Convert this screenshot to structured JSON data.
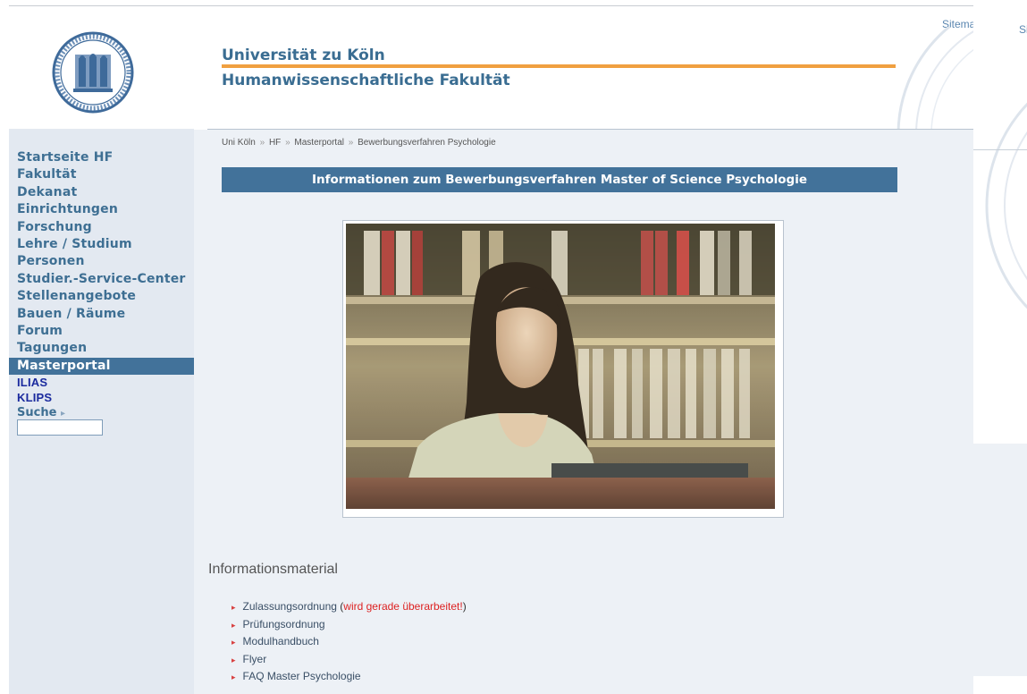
{
  "header": {
    "university": "Universität zu Köln",
    "faculty": "Humanwissenschaftliche Fakultät",
    "sitemap_link": "Sitemap",
    "right_pane_fragment": "Si"
  },
  "sidebar": {
    "items": [
      {
        "label": "Startseite HF"
      },
      {
        "label": "Fakultät"
      },
      {
        "label": "Dekanat"
      },
      {
        "label": "Einrichtungen"
      },
      {
        "label": "Forschung"
      },
      {
        "label": "Lehre / Studium"
      },
      {
        "label": "Personen"
      },
      {
        "label": "Studier.-Service-Center"
      },
      {
        "label": "Stellenangebote"
      },
      {
        "label": "Bauen / Räume"
      },
      {
        "label": "Forum"
      },
      {
        "label": "Tagungen"
      },
      {
        "label": "Masterportal",
        "active": true
      }
    ],
    "links": [
      "ILIAS",
      "KLIPS"
    ],
    "search_label": "Suche",
    "search_arrow": "▸",
    "search_value": ""
  },
  "breadcrumb": [
    "Uni Köln",
    "HF",
    "Masterportal",
    "Bewerbungsverfahren Psychologie"
  ],
  "breadcrumb_sep": "»",
  "banner_title": "Informationen zum Bewerbungsverfahren Master of Science Psychologie",
  "info": {
    "heading": "Informationsmaterial",
    "items": [
      {
        "label": "Zulassungsordnung",
        "note_open": " (",
        "note": "wird gerade überarbeitet!",
        "note_close": ")"
      },
      {
        "label": "Prüfungsordnung"
      },
      {
        "label": "Modulhandbuch"
      },
      {
        "label": "Flyer"
      },
      {
        "label": "FAQ Master Psychologie"
      }
    ],
    "bullet": "▸"
  },
  "colors": {
    "brand_blue": "#42729a",
    "title_blue": "#3a6d92",
    "accent_orange": "#f0a040",
    "link_red": "#dd2222",
    "sidebar_bg": "#e3e9f1",
    "content_bg": "#edf1f6"
  },
  "icons": {
    "seal": "university-seal-icon",
    "bullet": "red-triangle-bullet-icon",
    "search_arrow": "arrow-right-icon"
  }
}
